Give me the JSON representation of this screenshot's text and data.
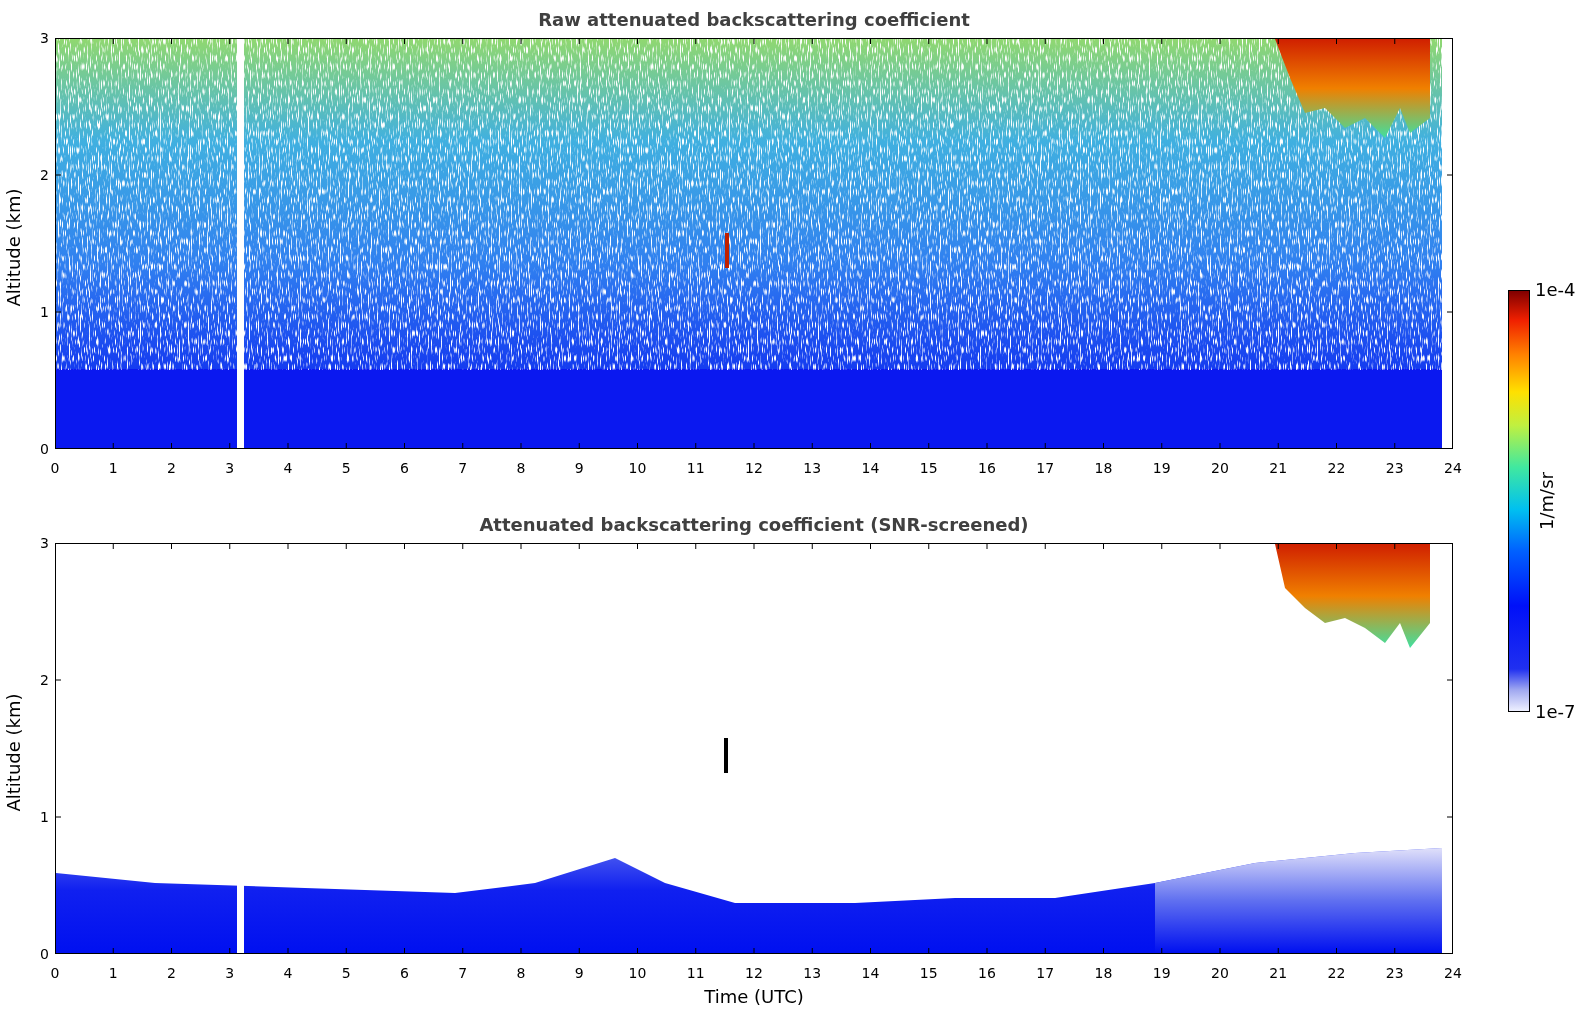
{
  "panels": [
    {
      "kind": "raw",
      "title": "Raw attenuated backscattering coefficient",
      "ylabel": "Altitude (km)",
      "yticks": [
        "3",
        "2",
        "1",
        "0"
      ],
      "xticks": [
        "0",
        "1",
        "2",
        "3",
        "4",
        "5",
        "6",
        "7",
        "8",
        "9",
        "10",
        "11",
        "12",
        "13",
        "14",
        "15",
        "16",
        "17",
        "18",
        "19",
        "20",
        "21",
        "22",
        "23",
        "24"
      ]
    },
    {
      "kind": "screened",
      "title": "Attenuated backscattering coefficient (SNR-screened)",
      "ylabel": "Altitude (km)",
      "yticks": [
        "3",
        "2",
        "1",
        "0"
      ],
      "xticks": [
        "0",
        "1",
        "2",
        "3",
        "4",
        "5",
        "6",
        "7",
        "8",
        "9",
        "10",
        "11",
        "12",
        "13",
        "14",
        "15",
        "16",
        "17",
        "18",
        "19",
        "20",
        "21",
        "22",
        "23",
        "24"
      ]
    }
  ],
  "xlabel": "Time (UTC)",
  "colorbar": {
    "max_label": "1e-4",
    "min_label": "1e-7",
    "label": "1/m/sr"
  }
}
